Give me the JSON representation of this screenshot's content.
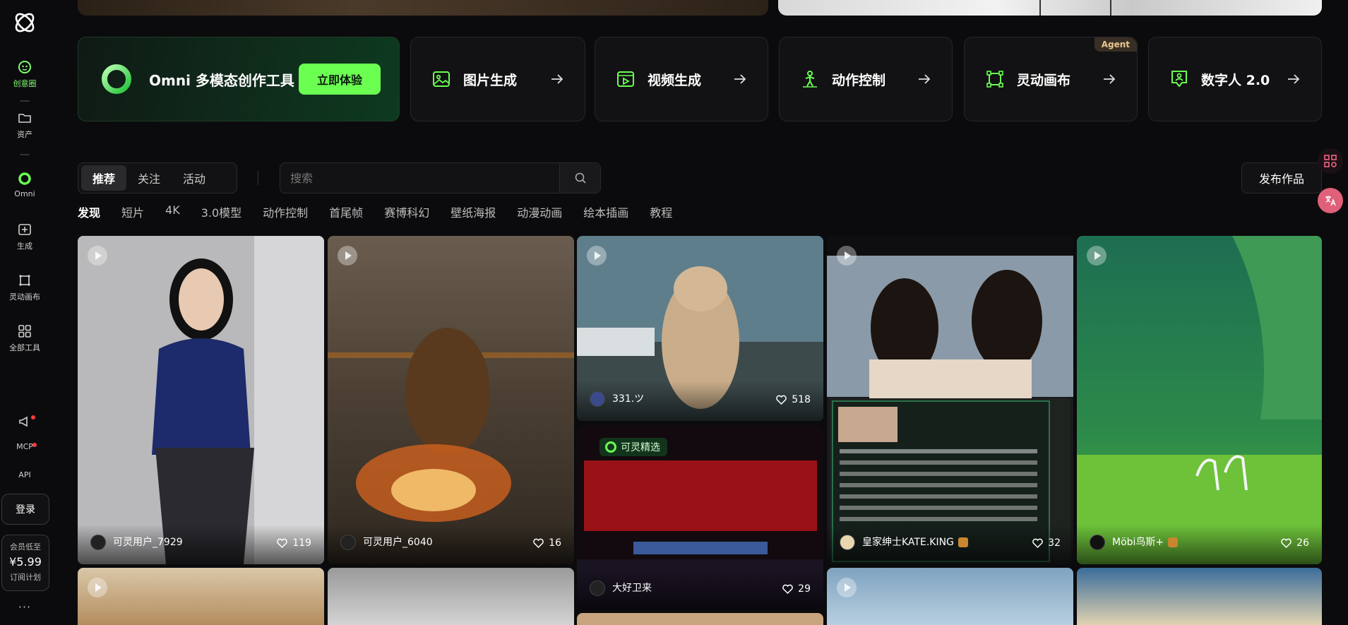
{
  "sidebar": {
    "items": [
      {
        "label": "创意圈",
        "icon": "creative-circle-icon"
      },
      {
        "label": "资产",
        "icon": "folder-icon"
      },
      {
        "label": "Omni",
        "icon": "omni-icon"
      },
      {
        "label": "生成",
        "icon": "generate-icon"
      },
      {
        "label": "灵动画布",
        "icon": "canvas-icon"
      },
      {
        "label": "全部工具",
        "icon": "grid-icon"
      }
    ],
    "mcp": "MCP",
    "api": "API",
    "login": "登录",
    "member": {
      "line1": "会员低至",
      "price": "¥5.99",
      "line3": "订阅计划"
    },
    "more": "···"
  },
  "tools": {
    "omni": {
      "label": "Omni 多模态创作工具",
      "cta": "立即体验"
    },
    "cards": [
      {
        "label": "图片生成",
        "icon": "image-icon"
      },
      {
        "label": "视频生成",
        "icon": "video-icon"
      },
      {
        "label": "动作控制",
        "icon": "motion-icon"
      },
      {
        "label": "灵动画布",
        "icon": "canvas-icon",
        "badge": "Agent"
      },
      {
        "label": "数字人 2.0",
        "icon": "digital-human-icon"
      }
    ]
  },
  "feed": {
    "tabs": [
      "推荐",
      "关注",
      "活动"
    ],
    "search_placeholder": "搜索",
    "publish": "发布作品",
    "categories": [
      "发现",
      "短片",
      "4K",
      "3.0模型",
      "动作控制",
      "首尾帧",
      "赛博科幻",
      "壁纸海报",
      "动漫动画",
      "绘本插画",
      "教程"
    ]
  },
  "grid": [
    {
      "user": "可灵用户_7929",
      "likes": "119"
    },
    {
      "user": "可灵用户_6040",
      "likes": "16"
    },
    {
      "user": "331.ツ",
      "likes": "518"
    },
    {
      "user": "大好卫来",
      "likes": "29",
      "tag": "可灵精选"
    },
    {
      "user": "皇家绅士KATE.KING",
      "likes": "32"
    },
    {
      "user": "Möbi鸟斯+",
      "likes": "26"
    }
  ],
  "colors": {
    "accent": "#6bff52",
    "bg": "#0b0b0d",
    "card": "#121214"
  }
}
